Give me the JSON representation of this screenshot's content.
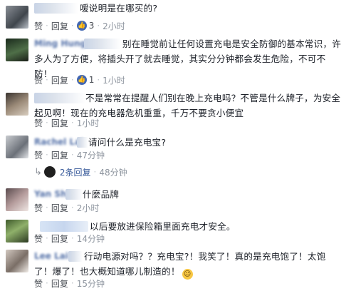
{
  "labels": {
    "like": "赞",
    "reply": "回复",
    "dot": "·"
  },
  "comments": [
    {
      "name": "",
      "text": "嗳说明是在哪买的?",
      "like_count": "3",
      "time": "2小时"
    },
    {
      "name": "Ming Hung",
      "text": "别在睡觉前让任何设置充电是安全防御的基本常识，许多人为了方便，将插头开了就去睡觉，其实分分钟都会发生危险，不可不防！",
      "like_count": "1",
      "time": "1小时"
    },
    {
      "name": "",
      "text": "不是常常在提醒人们别在晚上充电吗？不管是什么牌子，为安全起见啊！现在的充电器危机重重，千万不要贪小便宜",
      "time": "1小时"
    },
    {
      "name": "Rachel Lai",
      "text": "请问什么是充电宝?",
      "time": "47分钟",
      "replies_label": "2条回复",
      "replies_time": "48分钟"
    },
    {
      "name": "Yan Sh",
      "text": "什麼品牌",
      "time": "2小时"
    },
    {
      "name": "",
      "text": "以后要放进保险箱里面充电才安全。",
      "time": "14分钟"
    },
    {
      "name": "Lee Lai",
      "text": "行动电源对吗？？充电宝?！我笑了！真的是充电饱了！太饱了！爆了！也大概知道哪儿制造的！",
      "emoji": "☺",
      "time": "15分钟"
    }
  ]
}
